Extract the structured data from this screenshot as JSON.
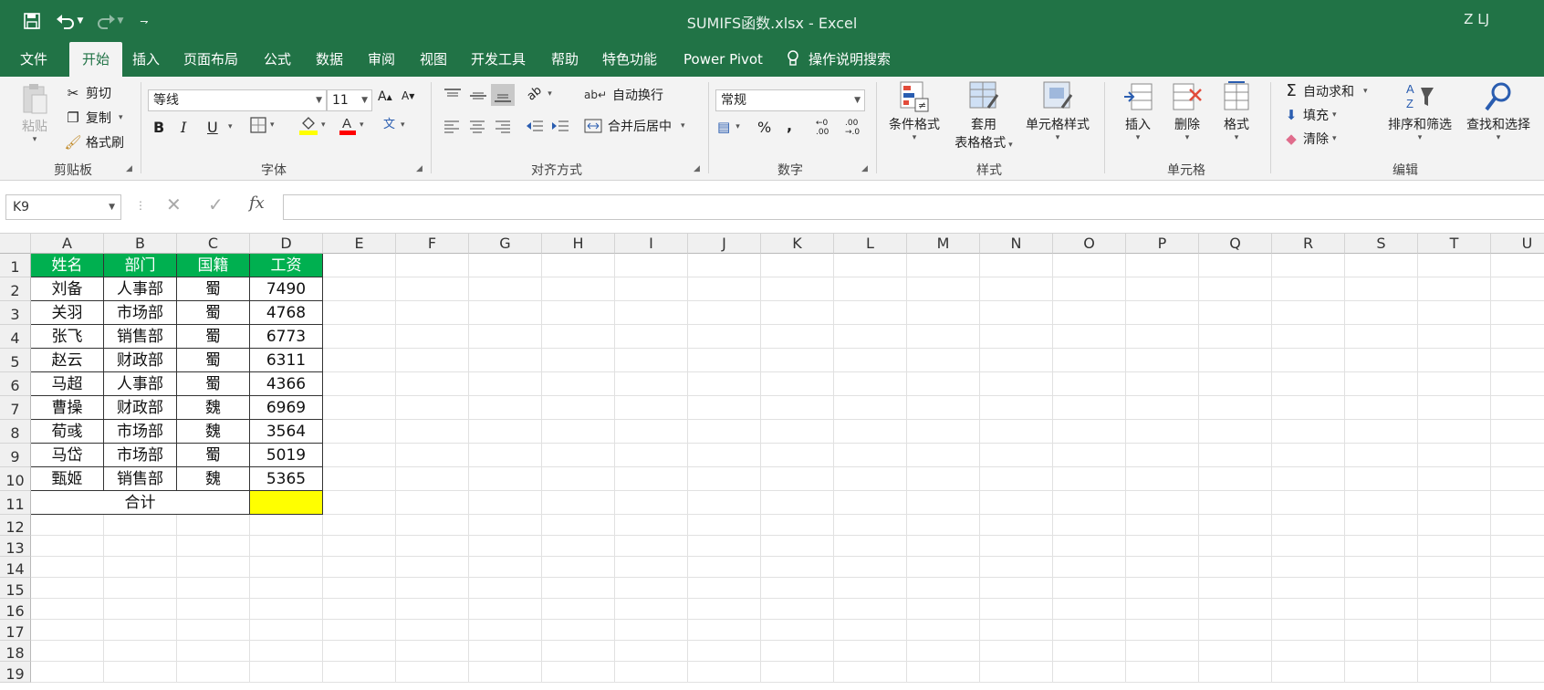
{
  "titlebar": {
    "title": "SUMIFS函数.xlsx  -  Excel",
    "user": "Z LJ"
  },
  "quick_access": {
    "save_icon": "save-icon",
    "undo_icon": "undo-icon",
    "redo_icon": "redo-icon",
    "customize_icon": "customize-icon"
  },
  "tabs": [
    "文件",
    "开始",
    "插入",
    "页面布局",
    "公式",
    "数据",
    "审阅",
    "视图",
    "开发工具",
    "帮助",
    "特色功能",
    "Power Pivot",
    "操作说明搜索"
  ],
  "active_tab": "开始",
  "ribbon": {
    "clipboard": {
      "paste": "粘贴",
      "cut": "剪切",
      "copy": "复制",
      "format_painter": "格式刷",
      "label": "剪贴板"
    },
    "font": {
      "name": "等线",
      "size": "11",
      "bold": "B",
      "italic": "I",
      "underline": "U",
      "label": "字体"
    },
    "alignment": {
      "wrap": "自动换行",
      "merge": "合并后居中",
      "label": "对齐方式"
    },
    "number": {
      "format": "常规",
      "label": "数字"
    },
    "styles": {
      "conditional": "条件格式",
      "table_line1": "套用",
      "table_line2": "表格格式",
      "cell_styles": "单元格样式",
      "label": "样式"
    },
    "cells": {
      "insert": "插入",
      "delete": "删除",
      "format": "格式",
      "label": "单元格"
    },
    "editing": {
      "autosum": "自动求和",
      "fill": "填充",
      "clear": "清除",
      "sort": "排序和筛选",
      "find": "查找和选择",
      "label": "编辑"
    }
  },
  "formula_bar": {
    "name_box": "K9",
    "fx": "fx",
    "formula": ""
  },
  "columns": [
    "A",
    "B",
    "C",
    "D",
    "E",
    "F",
    "G",
    "H",
    "I",
    "J",
    "K",
    "L",
    "M",
    "N",
    "O",
    "P",
    "Q",
    "R",
    "S",
    "T",
    "U"
  ],
  "rows": [
    "1",
    "2",
    "3",
    "4",
    "5",
    "6",
    "7",
    "8",
    "9",
    "10",
    "11",
    "12",
    "13",
    "14",
    "15",
    "16",
    "17",
    "18",
    "19"
  ],
  "table": {
    "headers": [
      "姓名",
      "部门",
      "国籍",
      "工资"
    ],
    "rows": [
      [
        "刘备",
        "人事部",
        "蜀",
        "7490"
      ],
      [
        "关羽",
        "市场部",
        "蜀",
        "4768"
      ],
      [
        "张飞",
        "销售部",
        "蜀",
        "6773"
      ],
      [
        "赵云",
        "财政部",
        "蜀",
        "6311"
      ],
      [
        "马超",
        "人事部",
        "蜀",
        "4366"
      ],
      [
        "曹操",
        "财政部",
        "魏",
        "6969"
      ],
      [
        "荀彧",
        "市场部",
        "魏",
        "3564"
      ],
      [
        "马岱",
        "市场部",
        "蜀",
        "5019"
      ],
      [
        "甄姬",
        "销售部",
        "魏",
        "5365"
      ]
    ],
    "total_label": "合计",
    "total_value": ""
  },
  "colors": {
    "accent": "#217346",
    "header_fill": "#00b050",
    "total_fill": "#ffff00"
  }
}
